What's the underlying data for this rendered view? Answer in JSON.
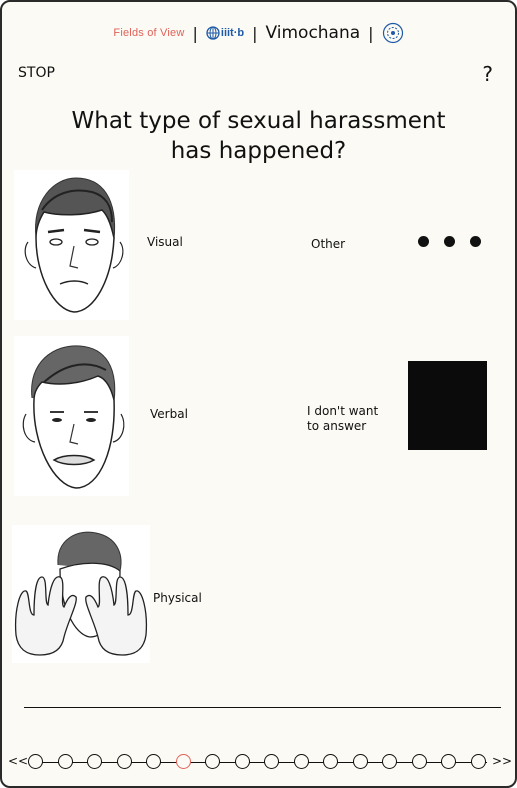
{
  "header": {
    "fields_of_view": "Fields of View",
    "separator": "|",
    "iiitb_logo_text": "iiit·b",
    "vimochana": "Vimochana"
  },
  "nav": {
    "stop_label": "STOP",
    "help_label": "?"
  },
  "question": {
    "line1": "What type of sexual harassment",
    "line2": "has happened?"
  },
  "options": {
    "visual": {
      "label": "Visual",
      "icon": "face-visual-icon"
    },
    "verbal": {
      "label": "Verbal",
      "icon": "face-verbal-icon"
    },
    "physical": {
      "label": "Physical",
      "icon": "face-physical-icon"
    },
    "other": {
      "label": "Other",
      "icon": "ellipsis-icon"
    },
    "no_answer": {
      "line1": "I don't want",
      "line2": "to answer",
      "icon": "black-square-icon"
    }
  },
  "pager": {
    "prev": "<<",
    "next": ">>",
    "total_pages": 16,
    "current_page": 6,
    "active_color": "#e0625a"
  },
  "colors": {
    "background": "#fbfaf4",
    "accent": "#e0625a",
    "logo_blue": "#1f5aa8"
  }
}
